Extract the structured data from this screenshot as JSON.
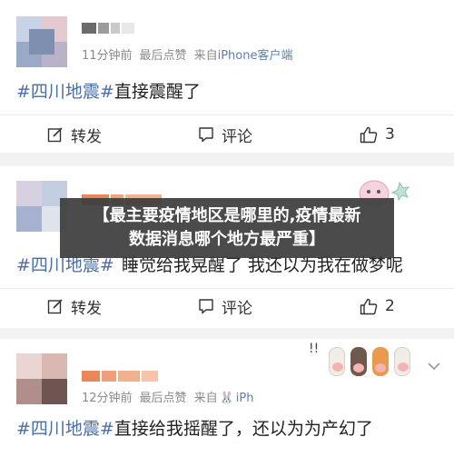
{
  "posts": [
    {
      "meta_time": "11分钟前",
      "meta_likes": "最后点赞",
      "meta_from": "来自",
      "meta_source": "iPhone客户端",
      "hashtag": "#四川地震#",
      "text": "直接震醒了",
      "repost_label": "转发",
      "comment_label": "评论",
      "like_count": "3"
    },
    {
      "hashtag": "#四川地震#",
      "text": "睡觉给我晃醒了 我还以为我在做梦呢",
      "repost_label": "转发",
      "comment_label": "评论",
      "like_count": "2"
    },
    {
      "meta_time": "12分钟前",
      "meta_likes": "最后点赞",
      "meta_from": "来自",
      "meta_source": "iPh",
      "hashtag": "#四川地震#",
      "text": "直接给我摇醒了，还以为为产幻了"
    }
  ],
  "overlay": {
    "line1": "【最主要疫情地区是哪里的,疫情最新",
    "line2": "数据消息哪个地方最严重】"
  },
  "icons": {
    "repost": "edit-icon",
    "comment": "comment-icon",
    "like": "thumbs-up-icon",
    "expand": "chevron-down-icon"
  },
  "colors": {
    "hashtag": "#4a6fa5",
    "source": "#5a7fb0",
    "overlay_bg": "#3c3c3c"
  }
}
